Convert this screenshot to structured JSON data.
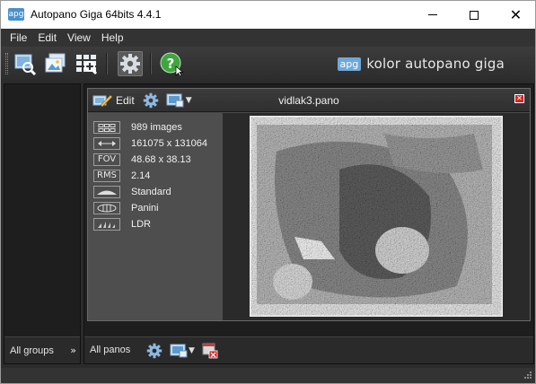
{
  "window": {
    "title": "Autopano Giga 64bits 4.4.1",
    "app_icon_text": "apg",
    "controls": {
      "minimize": "minimize-icon",
      "maximize": "maximize-icon",
      "close": "close-icon"
    }
  },
  "menu": {
    "items": [
      {
        "label": "File"
      },
      {
        "label": "Edit"
      },
      {
        "label": "View"
      },
      {
        "label": "Help"
      }
    ]
  },
  "toolbar": {
    "buttons": [
      {
        "icon": "select-images-icon"
      },
      {
        "icon": "import-images-icon"
      },
      {
        "icon": "detect-panoramas-icon"
      },
      {
        "icon": "settings-gear-icon",
        "active": true
      },
      {
        "icon": "help-icon"
      }
    ],
    "brand": {
      "badge": "apg",
      "text": "kolor autopano giga"
    }
  },
  "groups": {
    "footer_label": "All groups",
    "collapse_icon": "double-chevron-right-icon"
  },
  "pano": {
    "edit_label": "Edit",
    "title": "vidlak3.pano",
    "properties": [
      {
        "icon": "image-grid-icon",
        "icon_text": "",
        "value": "989 images"
      },
      {
        "icon": "dimensions-arrow-icon",
        "icon_text": "",
        "value": "161075 x 131064"
      },
      {
        "icon": "fov-icon",
        "icon_text": "FOV",
        "value": "48.68 x 38.13"
      },
      {
        "icon": "rms-icon",
        "icon_text": "RMS",
        "value": "2.14"
      },
      {
        "icon": "projection-standard-icon",
        "icon_text": "",
        "value": "Standard"
      },
      {
        "icon": "projection-panini-icon",
        "icon_text": "",
        "value": "Panini"
      },
      {
        "icon": "dynamic-range-icon",
        "icon_text": "",
        "value": "LDR"
      }
    ]
  },
  "panos_footer": {
    "label": "All panos"
  },
  "colors": {
    "dark_bg": "#2b2b2b",
    "card_bg": "#4a4a4a",
    "accent_blue": "#4a90c9",
    "close_red": "#e02020"
  }
}
